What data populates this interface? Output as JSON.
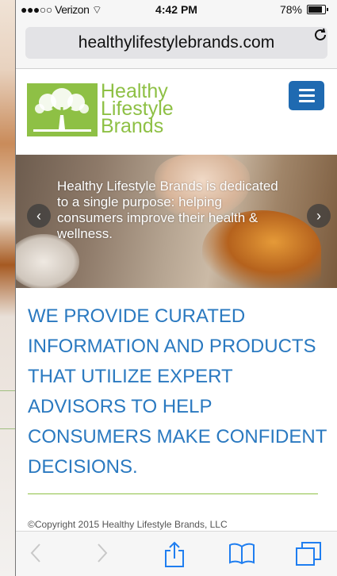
{
  "status": {
    "signal": "●●●○○",
    "carrier": "Verizon",
    "wifi": "⊕",
    "time": "4:42 PM",
    "battery_text": "78%",
    "battery_level": 0.78
  },
  "browser": {
    "url": "healthylifestylebrands.com",
    "reload_icon": "reload-icon"
  },
  "site": {
    "logo_line1": "Healthy",
    "logo_line2": "Lifestyle",
    "logo_line3": "Brands",
    "brand_color": "#8ec045",
    "menu_color": "#1f6ab1"
  },
  "hero": {
    "caption": "Healthy Lifestyle Brands is dedicated to a single purpose: helping consumers improve their health & wellness."
  },
  "content": {
    "headline": "WE PROVIDE CURATED INFORMATION AND PRODUCTS THAT UTILIZE EXPERT ADVISORS TO HELP CONSUMERS MAKE CONFIDENT DECISIONS.",
    "headline_color": "#2a79c0",
    "copyright": "©Copyright 2015 Healthy Lifestyle Brands, LLC"
  },
  "toolbar": {
    "back": "‹",
    "forward": "›",
    "share": "⇪",
    "bookmarks": "⧉",
    "tabs": "❐"
  }
}
